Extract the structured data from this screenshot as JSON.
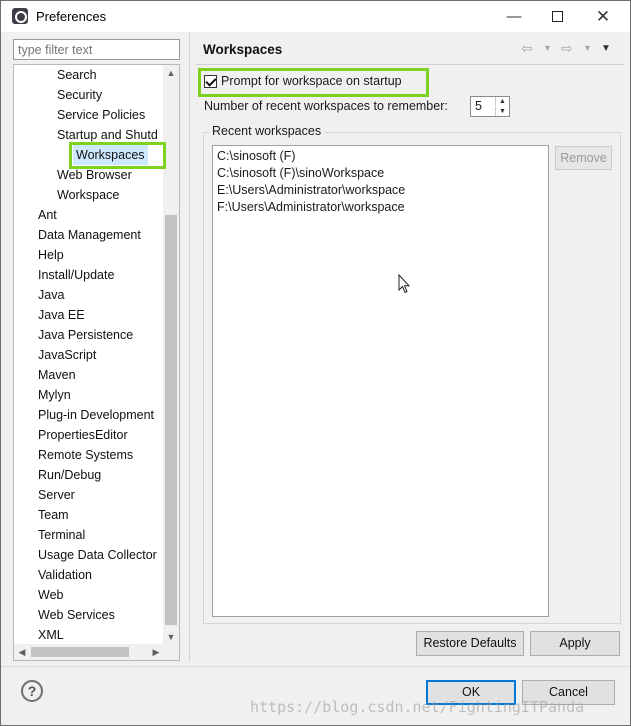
{
  "window": {
    "title": "Preferences",
    "min_glyph": "—",
    "close_glyph": "✕"
  },
  "filter": {
    "placeholder": "type filter text"
  },
  "tree": {
    "items": [
      {
        "label": "Search"
      },
      {
        "label": "Security"
      },
      {
        "label": "Service Policies"
      },
      {
        "label": "Startup and Shutd"
      },
      {
        "label": "Workspaces",
        "selected": true
      },
      {
        "label": "Web Browser"
      },
      {
        "label": "Workspace"
      },
      {
        "label": "Ant"
      },
      {
        "label": "Data Management"
      },
      {
        "label": "Help"
      },
      {
        "label": "Install/Update"
      },
      {
        "label": "Java"
      },
      {
        "label": "Java EE"
      },
      {
        "label": "Java Persistence"
      },
      {
        "label": "JavaScript"
      },
      {
        "label": "Maven"
      },
      {
        "label": "Mylyn"
      },
      {
        "label": "Plug-in Development"
      },
      {
        "label": "PropertiesEditor"
      },
      {
        "label": "Remote Systems"
      },
      {
        "label": "Run/Debug"
      },
      {
        "label": "Server"
      },
      {
        "label": "Team"
      },
      {
        "label": "Terminal"
      },
      {
        "label": "Usage Data Collector"
      },
      {
        "label": "Validation"
      },
      {
        "label": "Web"
      },
      {
        "label": "Web Services"
      },
      {
        "label": "XML"
      }
    ]
  },
  "page": {
    "title": "Workspaces",
    "prompt_label": "Prompt for workspace on startup",
    "prompt_checked": true,
    "recent_count_label": "Number of recent workspaces to remember:",
    "recent_count_value": "5",
    "group_title": "Recent workspaces",
    "workspaces": [
      "C:\\sinosoft (F)",
      "C:\\sinosoft (F)\\sinoWorkspace",
      "E:\\Users\\Administrator\\workspace",
      "F:\\Users\\Administrator\\workspace"
    ],
    "remove_label": "Remove"
  },
  "buttons": {
    "restore_defaults": "Restore Defaults",
    "apply": "Apply",
    "ok": "OK",
    "cancel": "Cancel",
    "help": "?"
  },
  "watermark": "https://blog.csdn.net/FightingITPanda",
  "colors": {
    "highlight": "#7ed321",
    "selection": "#cde8ff",
    "default_button_border": "#0078d7"
  },
  "icons": [
    "app-icon",
    "back-arrow-icon",
    "forward-arrow-icon",
    "view-menu-icon",
    "help-icon",
    "mouse-cursor-icon"
  ]
}
